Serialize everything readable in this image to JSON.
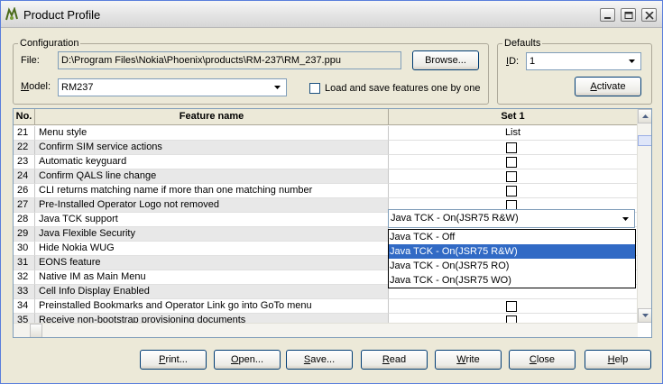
{
  "window": {
    "title": "Product Profile",
    "controls": [
      "minimize-icon",
      "maximize-icon",
      "close-icon"
    ]
  },
  "configuration": {
    "legend": "Configuration",
    "file_label": "File:",
    "file_value": "D:\\Program Files\\Nokia\\Phoenix\\products\\RM-237\\RM_237.ppu",
    "browse_label": "Browse...",
    "model_label": "Model:",
    "model_value": "RM237",
    "load_checkbox_label": "Load and save features one by one",
    "load_checkbox_checked": false
  },
  "defaults": {
    "legend": "Defaults",
    "id_label": "ID:",
    "id_value": "1",
    "activate_label": "Activate"
  },
  "grid": {
    "columns": [
      "No.",
      "Feature name",
      "Set 1"
    ],
    "rows": [
      {
        "no": "21",
        "name": "Menu style",
        "value": "List",
        "type": "text"
      },
      {
        "no": "22",
        "name": "Confirm SIM service actions",
        "value": "",
        "type": "check"
      },
      {
        "no": "23",
        "name": "Automatic keyguard",
        "value": "",
        "type": "check"
      },
      {
        "no": "24",
        "name": "Confirm QALS line change",
        "value": "",
        "type": "check"
      },
      {
        "no": "26",
        "name": "CLI returns matching name if more than one matching number",
        "value": "",
        "type": "check"
      },
      {
        "no": "27",
        "name": "Pre-Installed Operator Logo not removed",
        "value": "",
        "type": "check"
      },
      {
        "no": "28",
        "name": "Java TCK support",
        "value": "",
        "type": "combo"
      },
      {
        "no": "29",
        "name": "Java Flexible Security",
        "value": "",
        "type": "none"
      },
      {
        "no": "30",
        "name": "Hide Nokia WUG",
        "value": "",
        "type": "none"
      },
      {
        "no": "31",
        "name": "EONS feature",
        "value": "",
        "type": "none"
      },
      {
        "no": "32",
        "name": "Native IM as Main Menu",
        "value": "",
        "type": "none"
      },
      {
        "no": "33",
        "name": "Cell Info Display Enabled",
        "value": "",
        "type": "none"
      },
      {
        "no": "34",
        "name": "Preinstalled Bookmarks and Operator Link go into GoTo menu",
        "value": "",
        "type": "check"
      },
      {
        "no": "35",
        "name": "Receive non-bootstrap provisioning documents",
        "value": "",
        "type": "check"
      }
    ],
    "java_tck": {
      "selected": "Java TCK - On(JSR75 R&W)",
      "options": [
        "Java TCK - Off",
        "Java TCK - On(JSR75 R&W)",
        "Java TCK - On(JSR75 RO)",
        "Java TCK - On(JSR75 WO)"
      ],
      "highlighted_index": 1
    }
  },
  "buttons": {
    "print": "Print...",
    "open": "Open...",
    "save": "Save...",
    "read": "Read",
    "write": "Write",
    "close": "Close",
    "help": "Help"
  },
  "colors": {
    "window_bg": "#ece9d8",
    "selection": "#316ac5",
    "border": "#7f9db9"
  }
}
